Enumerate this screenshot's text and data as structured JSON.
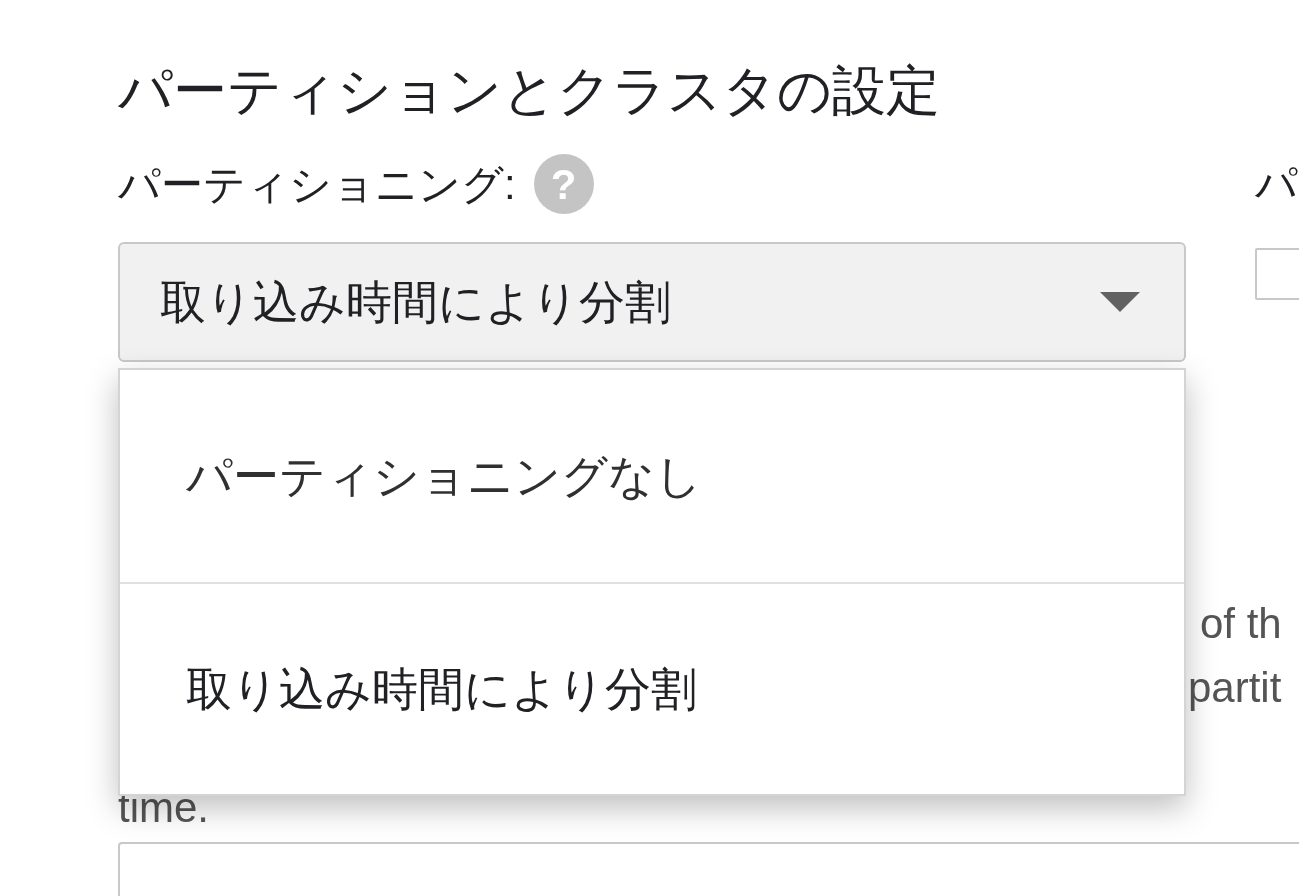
{
  "section_title": "パーティションとクラスタの設定",
  "partitioning": {
    "label": "パーティショニング:",
    "help_icon": "?",
    "select": {
      "value": "取り込み時間により分割",
      "expanded": true
    },
    "options": [
      {
        "label": "パーティショニングなし",
        "selected": false
      },
      {
        "label": "取り込み時間により分割",
        "selected": true
      }
    ]
  },
  "right_column": {
    "label": "パ",
    "checkbox": {
      "checked": false
    }
  },
  "description_lines": [
    "of th",
    "partit",
    "time."
  ]
}
